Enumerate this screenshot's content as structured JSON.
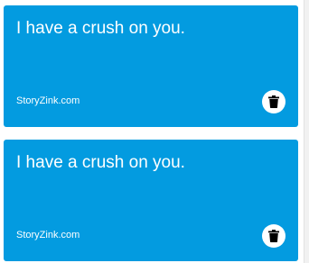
{
  "colors": {
    "card_bg": "#039be0",
    "card_text": "#ffffff",
    "button_bg": "#ffffff",
    "icon": "#000000"
  },
  "cards": [
    {
      "text": "I have a crush on you.",
      "source": "StoryZink.com",
      "delete_icon": "trash-icon"
    },
    {
      "text": "I have a crush on you.",
      "source": "StoryZink.com",
      "delete_icon": "trash-icon"
    }
  ]
}
